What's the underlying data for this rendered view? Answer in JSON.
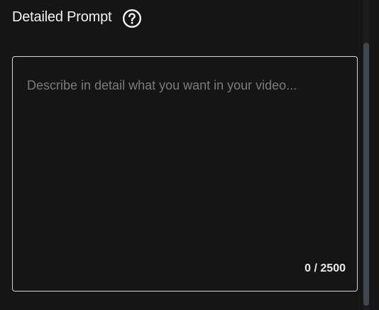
{
  "header": {
    "title": "Detailed Prompt",
    "help_icon": "question-circle-icon"
  },
  "prompt": {
    "value": "",
    "placeholder": "Describe in detail what you want in your video...",
    "counter": "0 / 2500",
    "max_length": 2500
  },
  "colors": {
    "background": "#151515",
    "border": "#d6d6d6",
    "placeholder": "#7b7b7b",
    "scrollbar_thumb": "#3f474f"
  }
}
